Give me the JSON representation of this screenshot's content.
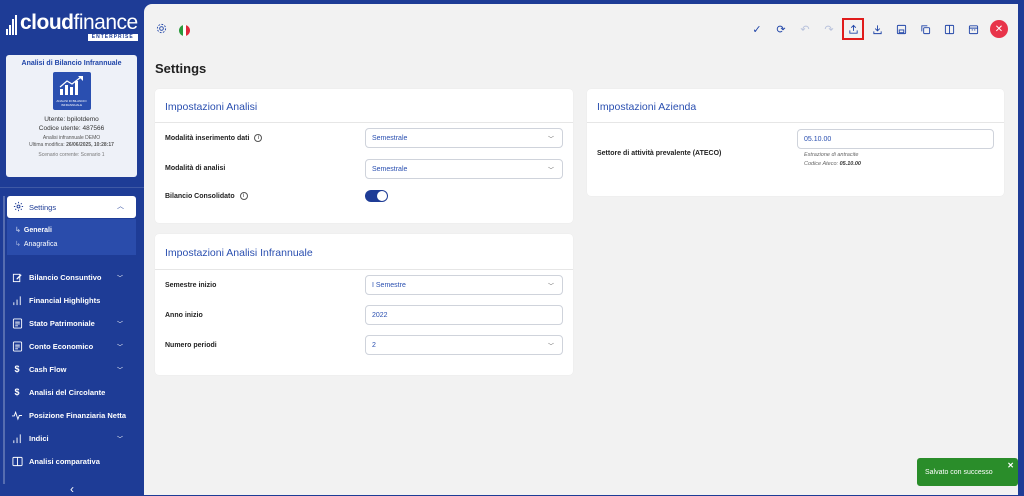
{
  "brand": {
    "bold": "cloud",
    "light": "finance",
    "edition": "ENTERPRISE"
  },
  "card": {
    "title": "Analisi di Bilancio Infrannuale",
    "image_caption": "ANALISI DI BILANCIO INFRANNUALE",
    "user": "Utente: bpilotdemo",
    "user_code": "Codice utente: 487566",
    "analysis_name": "Analisi infrannuale DEMO",
    "last_modified_label": "Ultima modifica:",
    "last_modified": "26/06/2025, 10:28:17",
    "scenario": "Scenario corrente: Scenario 1"
  },
  "nav": {
    "active": {
      "label": "Settings",
      "icon": "gear-icon"
    },
    "sub_items": [
      {
        "label": "Generali",
        "active": true
      },
      {
        "label": "Anagrafica",
        "active": false
      }
    ],
    "items": [
      {
        "label": "Bilancio Consuntivo",
        "icon": "edit-icon",
        "expandable": true
      },
      {
        "label": "Financial Highlights",
        "icon": "bars-icon",
        "expandable": false
      },
      {
        "label": "Stato Patrimoniale",
        "icon": "document-icon",
        "expandable": true
      },
      {
        "label": "Conto Economico",
        "icon": "document-icon",
        "expandable": true
      },
      {
        "label": "Cash Flow",
        "icon": "dollar-icon",
        "expandable": true
      },
      {
        "label": "Analisi del Circolante",
        "icon": "dollar-icon",
        "expandable": false
      },
      {
        "label": "Posizione Finanziaria Netta",
        "icon": "pulse-icon",
        "expandable": false
      },
      {
        "label": "Indici",
        "icon": "bars-icon",
        "expandable": true
      },
      {
        "label": "Analisi comparativa",
        "icon": "columns-icon",
        "expandable": false
      }
    ]
  },
  "page": {
    "title": "Settings"
  },
  "analisi": {
    "title": "Impostazioni Analisi",
    "modalita_inserimento": {
      "label": "Modalità inserimento dati",
      "value": "Semestrale"
    },
    "modalita_analisi": {
      "label": "Modalità di analisi",
      "value": "Semestrale"
    },
    "bilancio_consolidato": {
      "label": "Bilancio Consolidato",
      "on": true
    }
  },
  "infrannuale": {
    "title": "Impostazioni Analisi Infrannuale",
    "semestre_inizio": {
      "label": "Semestre inizio",
      "value": "I Semestre"
    },
    "anno_inizio": {
      "label": "Anno inizio",
      "value": "2022"
    },
    "numero_periodi": {
      "label": "Numero periodi",
      "value": "2"
    }
  },
  "azienda": {
    "title": "Impostazioni Azienda",
    "settore": {
      "label": "Settore di attività prevalente (ATECO)",
      "value": "05.10.00"
    },
    "hint_line1": "Estrazione di antracite",
    "hint_line2_label": "Codice Ateco:",
    "hint_line2_value": "05.10.00"
  },
  "toolbar": {
    "icons": [
      "check-icon",
      "refresh-icon",
      "undo-icon",
      "redo-icon",
      "upload-icon",
      "download-icon",
      "save-icon",
      "copy-icon",
      "split-view-icon",
      "calendar-icon",
      "close-icon"
    ]
  },
  "toast": {
    "message": "Salvato con successo"
  },
  "colors": {
    "primary": "#1e3c96",
    "accent": "#2a4fb0",
    "success": "#2a8d2a",
    "danger": "#e8344a",
    "highlight": "#e01c1c"
  }
}
